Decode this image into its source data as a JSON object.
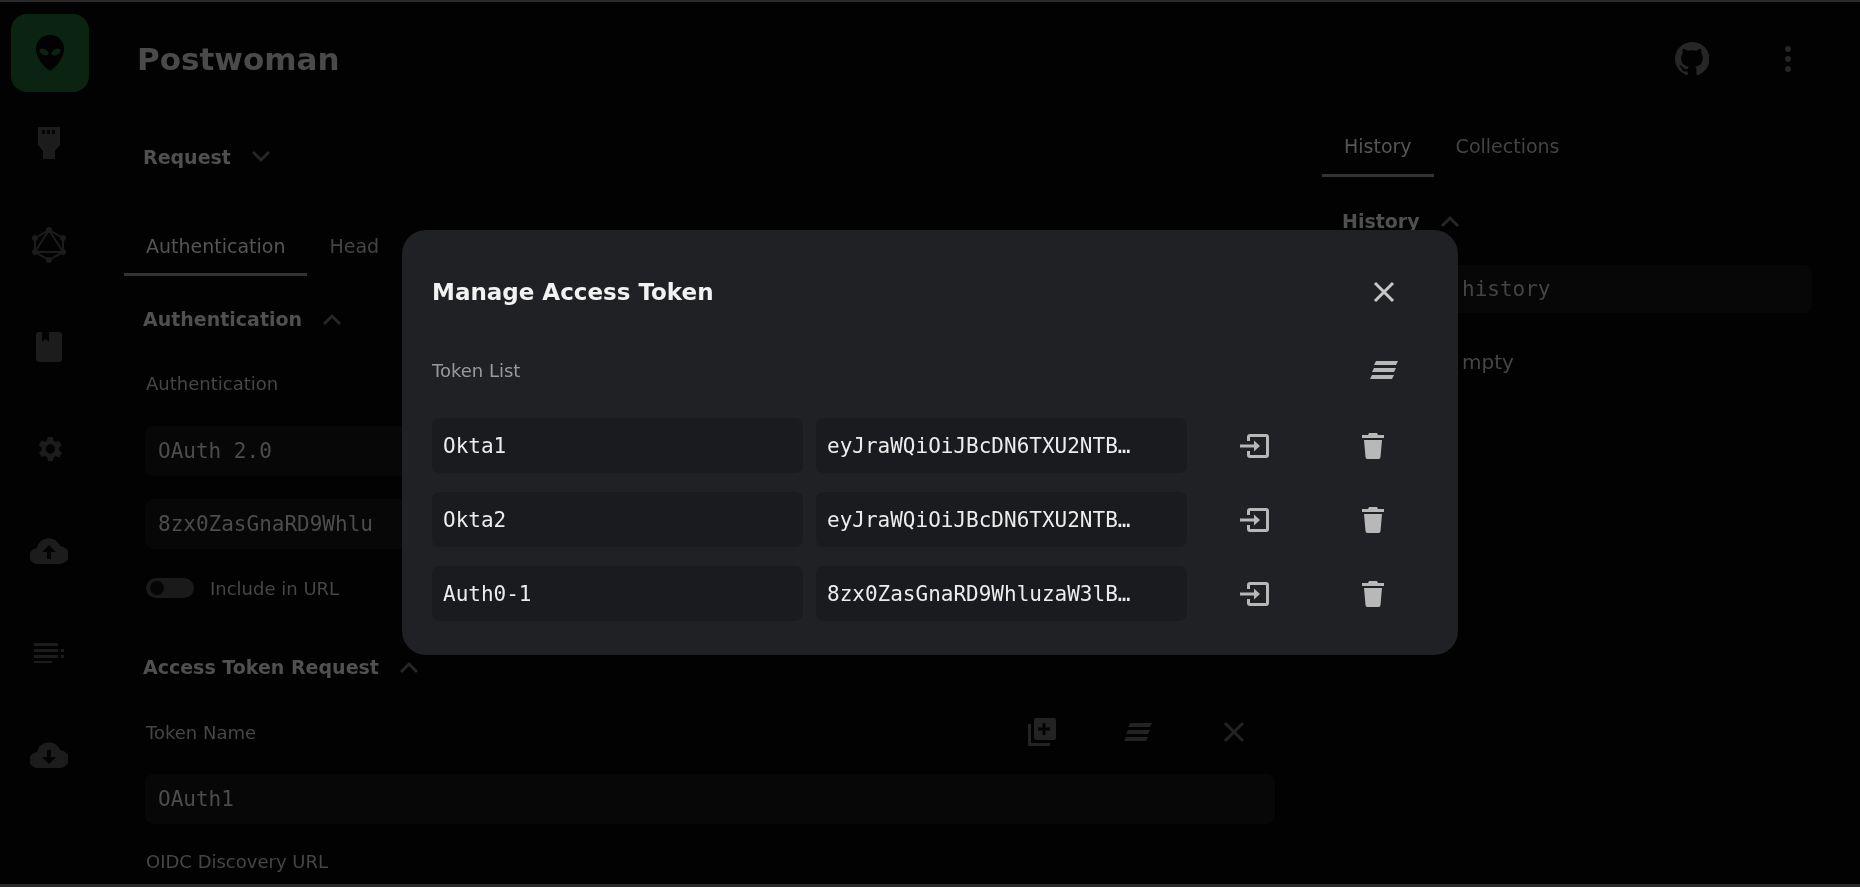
{
  "app": {
    "title": "Postwoman"
  },
  "request": {
    "label": "Request",
    "tabs": [
      {
        "label": "Authentication",
        "selected": true
      },
      {
        "label": "Head",
        "selected": false
      }
    ],
    "auth_section": {
      "title": "Authentication",
      "expanded": true,
      "field_label": "Authentication",
      "auth_type": "OAuth 2.0",
      "token_value": "8zx0ZasGnaRD9Whlu",
      "include_in_url": {
        "label": "Include in URL",
        "on": false
      }
    },
    "token_request": {
      "title": "Access Token Request",
      "expanded": true,
      "token_name_label": "Token Name",
      "token_name": "OAuth1",
      "oidc_label": "OIDC Discovery URL"
    }
  },
  "history_panel": {
    "tabs": [
      {
        "label": "History",
        "selected": true
      },
      {
        "label": "Collections",
        "selected": false
      }
    ],
    "section": {
      "title": "History",
      "expanded": true
    },
    "search_placeholder": "history",
    "empty_message": "mpty"
  },
  "modal": {
    "title": "Manage Access Token",
    "list_label": "Token List",
    "tokens": [
      {
        "name": "Okta1",
        "value": "eyJraWQiOiJBcDN6TXU2NTB…"
      },
      {
        "name": "Okta2",
        "value": "eyJraWQiOiJBcDN6TXU2NTB…"
      },
      {
        "name": "Auth0-1",
        "value": "8zx0ZasGnaRD9WhluzaW3lB…"
      }
    ]
  }
}
